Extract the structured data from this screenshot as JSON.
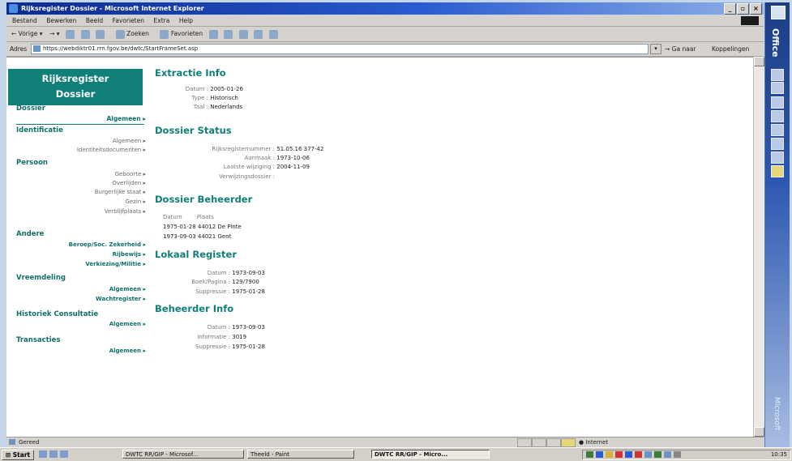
{
  "window": {
    "title": "Rijksregister Dossier - Microsoft Internet Explorer"
  },
  "menu": [
    "Bestand",
    "Bewerken",
    "Beeld",
    "Favorieten",
    "Extra",
    "Help"
  ],
  "toolbar": {
    "back_label": "Vorige",
    "search_label": "Zoeken",
    "favorites_label": "Favorieten"
  },
  "address": {
    "label": "Adres",
    "url": "https://webdiktr01.rrn.fgov.be/dwtc/StartFrameSet.asp",
    "go_label": "Ga naar",
    "links_label": "Koppelingen"
  },
  "office_bar": {
    "title": "Office",
    "brand": "Microsoft"
  },
  "sidebar": {
    "logo_line1": "Rijksregister",
    "logo_line2": "Dossier",
    "dossier": {
      "title": "Dossier",
      "link": "Algemeen"
    },
    "identificatie": {
      "title": "Identificatie",
      "links": [
        "Algemeen",
        "Identiteitsdocumenten"
      ]
    },
    "persoon": {
      "title": "Persoon",
      "links": [
        "Geboorte",
        "Overlijden",
        "Burgerlijke staat",
        "Gezin",
        "Verblijfplaats"
      ]
    },
    "andere": {
      "title": "Andere",
      "links": [
        "Beroep/Soc. Zekerheid",
        "Rijbewijs",
        "Verkiezing/Militie"
      ]
    },
    "vreemdeling": {
      "title": "Vreemdeling",
      "links": [
        "Algemeen",
        "Wachtregister"
      ]
    },
    "historiek": {
      "title": "Historiek Consultatie",
      "links": [
        "Algemeen"
      ]
    },
    "transacties": {
      "title": "Transacties",
      "links": [
        "Algemeen"
      ]
    }
  },
  "extractie": {
    "title": "Extractie Info",
    "rows": [
      {
        "label": "Datum :",
        "value": "2005-01-26"
      },
      {
        "label": "Type :",
        "value": "Historisch"
      },
      {
        "label": "Taal :",
        "value": "Nederlands"
      }
    ]
  },
  "status": {
    "title": "Dossier Status",
    "rows": [
      {
        "label": "Rijksregisternummer :",
        "value": "51.05.16 377-42"
      },
      {
        "label": "Aanmaak :",
        "value": "1973-10-06"
      },
      {
        "label": "Laatste wijziging :",
        "value": "2004-11-09"
      },
      {
        "label": "Verwijzingsdossier :",
        "value": ""
      }
    ]
  },
  "beheerder": {
    "title": "Dossier Beheerder",
    "col_datum": "Datum",
    "col_plaats": "Plaats",
    "rows": [
      "1975-01-28 44012 De Pinte",
      "1973-09-03 44021 Gent"
    ]
  },
  "lokaal": {
    "title": "Lokaal Register",
    "rows": [
      {
        "label": "Datum :",
        "value": "1973-09-03"
      },
      {
        "label": "Boek/Pagina :",
        "value": "129/7900"
      },
      {
        "label": "Suppressie :",
        "value": "1975-01-28"
      }
    ]
  },
  "beheerder_info": {
    "title": "Beheerder Info",
    "rows": [
      {
        "label": "Datum :",
        "value": "1973-09-03"
      },
      {
        "label": "Informatie :",
        "value": "3019"
      },
      {
        "label": "Suppressie :",
        "value": "1975-01-28"
      }
    ]
  },
  "statusbar": {
    "left": "Gereed",
    "zone": "Internet"
  },
  "taskbar": {
    "start": "Start",
    "tasks": [
      "DWTC RR/GIP - Microsof...",
      "Theeld - Paint",
      "DWTC RR/GIP - Micro..."
    ],
    "clock": "10:35"
  }
}
